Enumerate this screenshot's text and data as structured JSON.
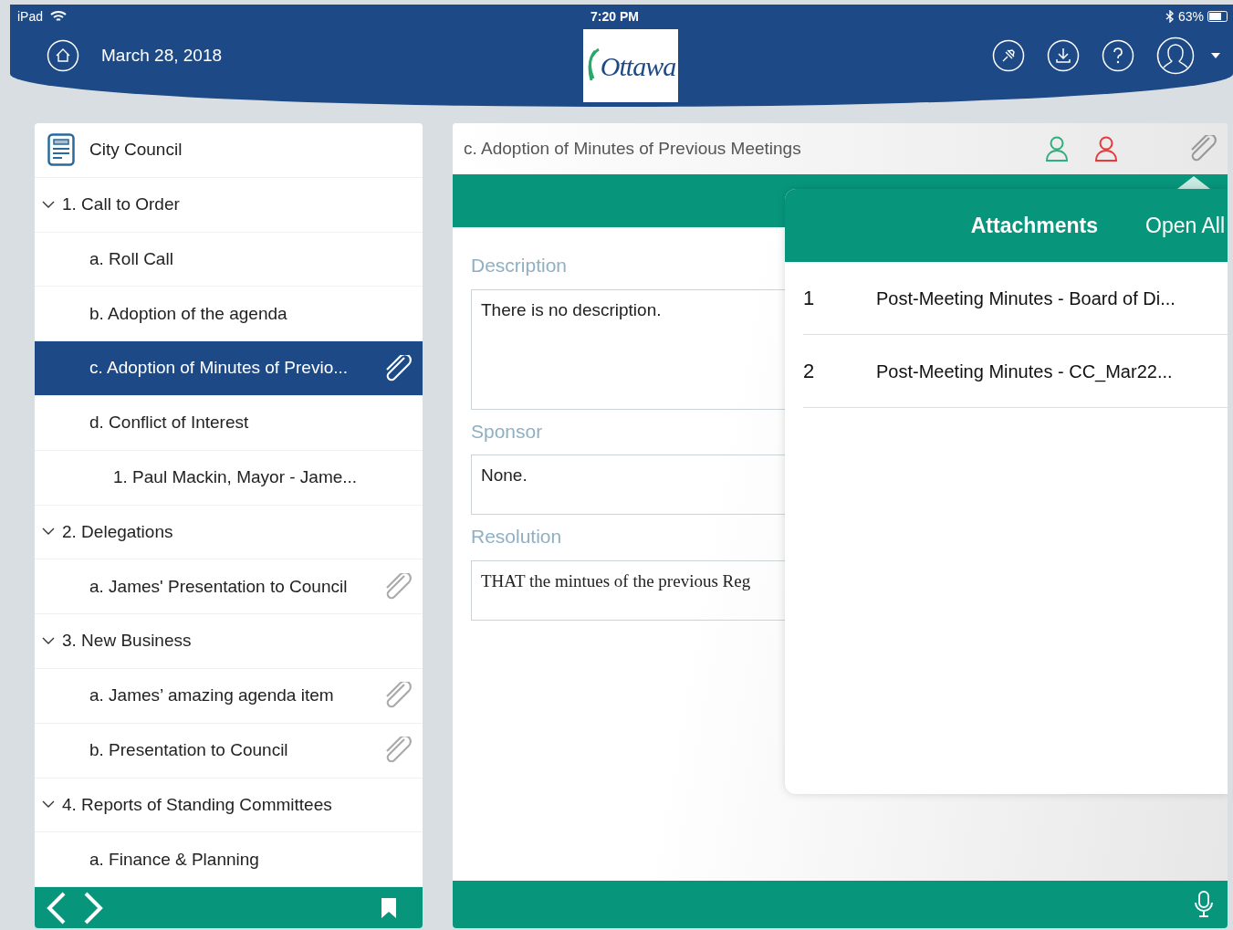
{
  "status_bar": {
    "device": "iPad",
    "time": "7:20 PM",
    "battery": "63%"
  },
  "header": {
    "date": "March 28, 2018",
    "logo": "Ottawa"
  },
  "sidebar": {
    "title": "City Council",
    "items": [
      {
        "label": "1. Call to Order",
        "expanded": true,
        "attachment": false,
        "selected": false,
        "children": [
          {
            "label": "a. Roll Call",
            "attachment": false,
            "selected": false
          },
          {
            "label": "b. Adoption of the agenda",
            "attachment": false,
            "selected": false
          },
          {
            "label": "c. Adoption of Minutes of Previo...",
            "attachment": true,
            "selected": true
          },
          {
            "label": "d. Conflict of Interest",
            "attachment": false,
            "selected": false,
            "children": [
              {
                "label": "1. Paul Mackin, Mayor - Jame...",
                "attachment": false,
                "selected": false
              }
            ]
          }
        ]
      },
      {
        "label": "2. Delegations",
        "expanded": true,
        "attachment": false,
        "selected": false,
        "children": [
          {
            "label": "a. James' Presentation to Council",
            "attachment": true,
            "selected": false
          }
        ]
      },
      {
        "label": "3. New Business",
        "expanded": true,
        "attachment": false,
        "selected": false,
        "children": [
          {
            "label": "a. James’ amazing agenda item",
            "attachment": true,
            "selected": false
          },
          {
            "label": "b. Presentation to Council",
            "attachment": true,
            "selected": false
          }
        ]
      },
      {
        "label": "4. Reports of Standing Committees",
        "expanded": true,
        "attachment": false,
        "selected": false,
        "children": [
          {
            "label": "a. Finance & Planning",
            "attachment": false,
            "selected": false
          }
        ]
      }
    ]
  },
  "detail": {
    "title": "c. Adoption of Minutes of Previous Meetings",
    "sections": [
      {
        "label": "Description",
        "value": "There is no description.",
        "kind": "plain"
      },
      {
        "label": "Sponsor",
        "value": "None.",
        "kind": "plain"
      },
      {
        "label": "Resolution",
        "value": "THAT the mintues of the previous Reg",
        "kind": "serif"
      }
    ]
  },
  "attachments": {
    "title": "Attachments",
    "open_all": "Open All",
    "items": [
      {
        "number": "1",
        "name": "Post-Meeting Minutes - Board of Di..."
      },
      {
        "number": "2",
        "name": "Post-Meeting Minutes - CC_Mar22..."
      }
    ]
  }
}
